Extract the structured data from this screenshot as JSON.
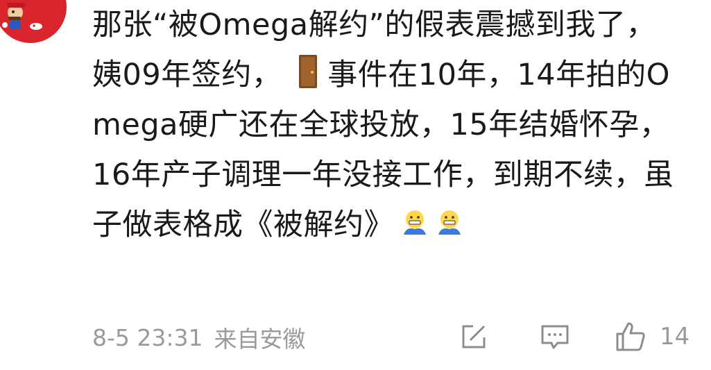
{
  "comment": {
    "avatar": "mario-avatar",
    "text_before_door": "那张“被Omega解约”的假表震撼到我了，姨09年签约，",
    "door_emoji": "door-emoji",
    "text_after_door": "事件在10年，14年拍的Omega硬广还在全球投放，15年结婚怀孕，16年产子调理一年没接工作，到期不续，虽子做表格成《被解约》",
    "trailing_emojis": [
      "grimacing-hands-emoji",
      "grimacing-hands-emoji"
    ]
  },
  "meta": {
    "date": "8-5 23:31",
    "location": "来自安徽"
  },
  "actions": {
    "edit_icon": "edit-square-icon",
    "comment_icon": "comment-bubble-icon",
    "like_icon": "thumbs-up-icon",
    "like_count": "14"
  },
  "colors": {
    "text": "#1a1a1a",
    "meta": "#9a9a9a",
    "avatar_bg": "#d9262e"
  }
}
